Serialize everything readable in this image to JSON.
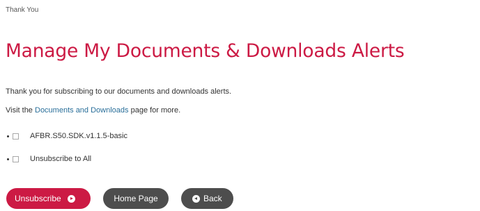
{
  "breadcrumb": "Thank You",
  "title": "Manage My Documents & Downloads Alerts",
  "message": "Thank you for subscribing to our documents and downloads alerts.",
  "visit_prefix": "Visit the",
  "visit_link": "Documents and Downloads",
  "visit_suffix": "page for more.",
  "options": [
    {
      "label": "AFBR.S50.SDK.v1.1.5-basic",
      "checked": false
    },
    {
      "label": "Unsubscribe to All",
      "checked": false
    }
  ],
  "buttons": {
    "unsubscribe": "Unsubscribe",
    "home": "Home Page",
    "back": "Back"
  },
  "colors": {
    "accent": "#cc1a44",
    "dark_button": "#4d4d4d",
    "link": "#2a6f9a"
  }
}
